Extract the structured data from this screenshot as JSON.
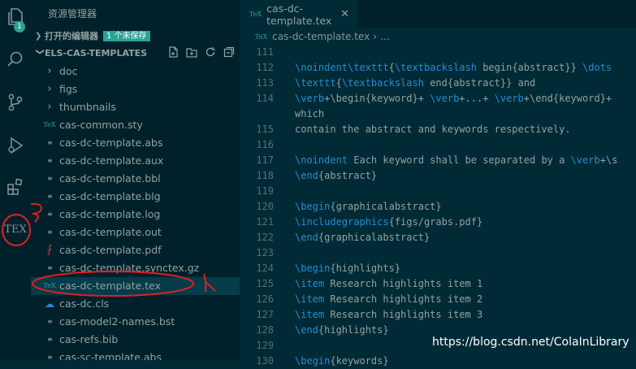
{
  "activity_bar": {
    "explorer_badge": "1",
    "tex_label": "TEX"
  },
  "sidebar": {
    "title": "资源管理器",
    "open_editors": {
      "label": "打开的编辑器",
      "unsaved_badge": "1 个未保存"
    },
    "workspace": {
      "label": "ELS-CAS-TEMPLATES"
    },
    "items": [
      {
        "name": "doc",
        "kind": "folder"
      },
      {
        "name": "figs",
        "kind": "folder"
      },
      {
        "name": "thumbnails",
        "kind": "folder"
      },
      {
        "name": "cas-common.sty",
        "kind": "tex"
      },
      {
        "name": "cas-dc-template.abs",
        "kind": "text"
      },
      {
        "name": "cas-dc-template.aux",
        "kind": "text"
      },
      {
        "name": "cas-dc-template.bbl",
        "kind": "text"
      },
      {
        "name": "cas-dc-template.blg",
        "kind": "text"
      },
      {
        "name": "cas-dc-template.log",
        "kind": "text"
      },
      {
        "name": "cas-dc-template.out",
        "kind": "text"
      },
      {
        "name": "cas-dc-template.pdf",
        "kind": "pdf"
      },
      {
        "name": "cas-dc-template.synctex.gz",
        "kind": "text"
      },
      {
        "name": "cas-dc-template.tex",
        "kind": "tex",
        "selected": true
      },
      {
        "name": "cas-dc.cls",
        "kind": "cls"
      },
      {
        "name": "cas-model2-names.bst",
        "kind": "text"
      },
      {
        "name": "cas-refs.bib",
        "kind": "text"
      },
      {
        "name": "cas-sc-template.abs",
        "kind": "text"
      }
    ]
  },
  "editor": {
    "tab": {
      "label": "cas-dc-template.tex"
    },
    "breadcrumb": {
      "file": "cas-dc-template.tex",
      "more": "…"
    },
    "lines": [
      {
        "n": "111",
        "segs": []
      },
      {
        "n": "112",
        "segs": [
          [
            "kw",
            "\\noindent\\texttt"
          ],
          [
            "t",
            "{"
          ],
          [
            "kw",
            "\\textbackslash"
          ],
          [
            "t",
            " begin{abstract}} "
          ],
          [
            "kw",
            "\\dots"
          ]
        ]
      },
      {
        "n": "113",
        "segs": [
          [
            "kw",
            "\\texttt"
          ],
          [
            "t",
            "{"
          ],
          [
            "kw",
            "\\textbackslash"
          ],
          [
            "t",
            " end{abstract}} and"
          ]
        ]
      },
      {
        "n": "114",
        "segs": [
          [
            "kw",
            "\\verb"
          ],
          [
            "t",
            "+\\begin{keyword}+ "
          ],
          [
            "kw",
            "\\verb"
          ],
          [
            "t",
            "+...+ "
          ],
          [
            "kw",
            "\\verb"
          ],
          [
            "t",
            "+\\end{keyword}+"
          ]
        ]
      },
      {
        "n": "",
        "segs": [
          [
            "t",
            "which"
          ]
        ]
      },
      {
        "n": "115",
        "segs": [
          [
            "t",
            "contain the abstract and keywords respectively."
          ]
        ]
      },
      {
        "n": "116",
        "segs": []
      },
      {
        "n": "117",
        "segs": [
          [
            "kw",
            "\\noindent"
          ],
          [
            "t",
            " Each keyword shall be separated by a "
          ],
          [
            "kw",
            "\\verb"
          ],
          [
            "t",
            "+\\s"
          ]
        ]
      },
      {
        "n": "118",
        "segs": [
          [
            "kw",
            "\\end"
          ],
          [
            "t",
            "{abstract}"
          ]
        ]
      },
      {
        "n": "119",
        "segs": []
      },
      {
        "n": "120",
        "segs": [
          [
            "kw",
            "\\begin"
          ],
          [
            "t",
            "{graphicalabstract}"
          ]
        ]
      },
      {
        "n": "121",
        "segs": [
          [
            "kw",
            "\\includegraphics"
          ],
          [
            "t",
            "{figs/grabs.pdf}"
          ]
        ]
      },
      {
        "n": "122",
        "segs": [
          [
            "kw",
            "\\end"
          ],
          [
            "t",
            "{graphicalabstract}"
          ]
        ]
      },
      {
        "n": "123",
        "segs": []
      },
      {
        "n": "124",
        "segs": [
          [
            "kw",
            "\\begin"
          ],
          [
            "t",
            "{highlights}"
          ]
        ]
      },
      {
        "n": "125",
        "segs": [
          [
            "kw",
            "\\item"
          ],
          [
            "t",
            " Research highlights item 1"
          ]
        ]
      },
      {
        "n": "126",
        "segs": [
          [
            "kw",
            "\\item"
          ],
          [
            "t",
            " Research highlights item 2"
          ]
        ]
      },
      {
        "n": "127",
        "segs": [
          [
            "kw",
            "\\item"
          ],
          [
            "t",
            " Research highlights item 3"
          ]
        ]
      },
      {
        "n": "128",
        "segs": [
          [
            "kw",
            "\\end"
          ],
          [
            "t",
            "{highlights}"
          ]
        ]
      },
      {
        "n": "129",
        "segs": []
      },
      {
        "n": "130",
        "segs": [
          [
            "kw",
            "\\begin"
          ],
          [
            "t",
            "{keywords}"
          ]
        ]
      }
    ]
  },
  "watermark": "https://blog.csdn.net/ColaInLibrary",
  "colors": {
    "background": "#002b36",
    "sidebar": "#00212b",
    "accent": "#2aa198",
    "keyword": "#268bd2",
    "annotation": "#e02020"
  }
}
